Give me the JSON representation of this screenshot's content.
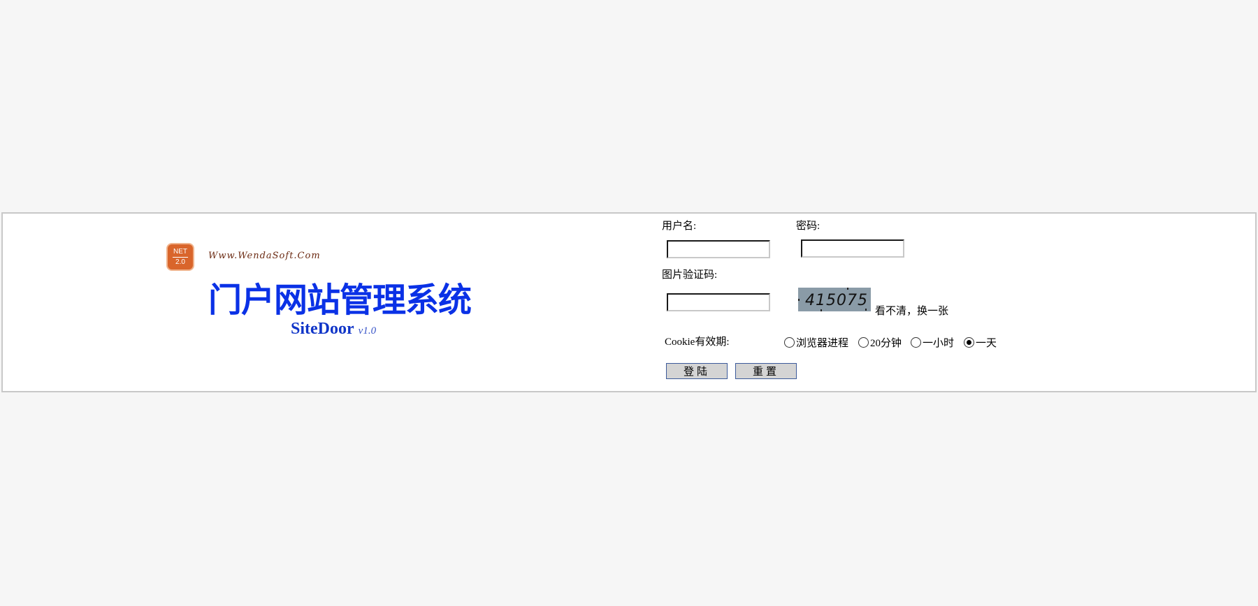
{
  "logo": {
    "badge_top": "NET",
    "badge_bottom": "2.0",
    "url": "Www.WendaSoft.Com",
    "title": "门户网站管理系统",
    "brand": "SiteDoor",
    "version": "v1.0"
  },
  "form": {
    "username_label": "用户名:",
    "username_value": "",
    "password_label": "密码:",
    "password_value": "",
    "captcha_label": "图片验证码:",
    "captcha_value": "",
    "captcha_code": "415075",
    "refresh_link": "看不清，换一张",
    "cookie_label": "Cookie有效期:",
    "cookie_options": [
      {
        "label": "浏览器进程",
        "checked": false
      },
      {
        "label": "20分钟",
        "checked": false
      },
      {
        "label": "一小时",
        "checked": false
      },
      {
        "label": "一天",
        "checked": true
      }
    ],
    "login_button": "登陆",
    "reset_button": "重置"
  }
}
